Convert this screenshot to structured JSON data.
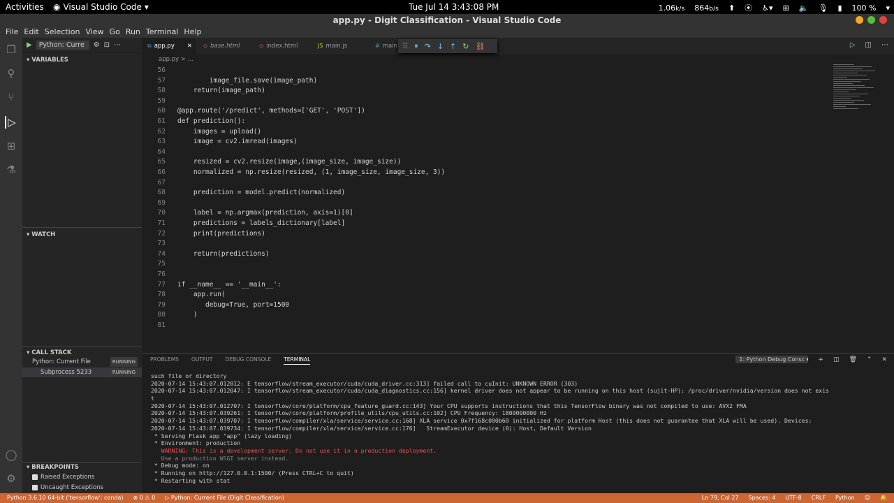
{
  "system": {
    "activities": "Activities",
    "app_name": "Visual Studio Code",
    "clock": "Tue Jul 14   3:43:08 PM",
    "net_down": "1.06",
    "net_down_unit": "k/s",
    "net_up": "864",
    "net_up_unit": "b/s",
    "battery": "100 %"
  },
  "window": {
    "title": "app.py - Digit Classification - Visual Studio Code"
  },
  "menu": [
    "File",
    "Edit",
    "Selection",
    "View",
    "Go",
    "Run",
    "Terminal",
    "Help"
  ],
  "sidebar": {
    "config": "Python: Curre",
    "variables": "VARIABLES",
    "watch": "WATCH",
    "call_stack": "CALL STACK",
    "cs_items": [
      {
        "label": "Python: Current File",
        "status": "RUNNING"
      },
      {
        "label": "Subprocess 5233",
        "status": "RUNNING"
      }
    ],
    "breakpoints": "BREAKPOINTS",
    "bp_items": [
      "Raised Exceptions",
      "Uncaught Exceptions"
    ]
  },
  "tabs": [
    "app.py",
    "base.html",
    "index.html",
    "main.js",
    "main."
  ],
  "breadcrumb": "app.py > ...",
  "code": [
    {
      "n": "56",
      "t": ""
    },
    {
      "n": "57",
      "t": "        image_file.save(image_path)"
    },
    {
      "n": "58",
      "t": "    return(image_path)"
    },
    {
      "n": "59",
      "t": ""
    },
    {
      "n": "60",
      "t": "@app.route('/predict', methods=['GET', 'POST'])"
    },
    {
      "n": "61",
      "t": "def prediction():"
    },
    {
      "n": "62",
      "t": "    images = upload()"
    },
    {
      "n": "63",
      "t": "    image = cv2.imread(images)"
    },
    {
      "n": "64",
      "t": ""
    },
    {
      "n": "65",
      "t": "    resized = cv2.resize(image,(image_size, image_size))"
    },
    {
      "n": "66",
      "t": "    normalized = np.resize(resized, (1, image_size, image_size, 3))"
    },
    {
      "n": "67",
      "t": ""
    },
    {
      "n": "68",
      "t": "    prediction = model.predict(normalized)"
    },
    {
      "n": "69",
      "t": ""
    },
    {
      "n": "70",
      "t": "    label = np.argmax(prediction, axis=1)[0]"
    },
    {
      "n": "71",
      "t": "    predictions = labels_dictionary[label]"
    },
    {
      "n": "72",
      "t": "    print(predictions)"
    },
    {
      "n": "73",
      "t": ""
    },
    {
      "n": "74",
      "t": "    return(predictions)"
    },
    {
      "n": "75",
      "t": ""
    },
    {
      "n": "76",
      "t": ""
    },
    {
      "n": "77",
      "t": "if __name__ == '__main__':"
    },
    {
      "n": "78",
      "t": "    app.run("
    },
    {
      "n": "79",
      "t": "       debug=True, port=1500"
    },
    {
      "n": "80",
      "t": "    )"
    },
    {
      "n": "81",
      "t": ""
    }
  ],
  "panel": {
    "tabs": [
      "PROBLEMS",
      "OUTPUT",
      "DEBUG CONSOLE",
      "TERMINAL"
    ],
    "terminal_select": "1: Python Debug Consc"
  },
  "terminal": [
    {
      "c": "",
      "t": "such file or directory"
    },
    {
      "c": "",
      "t": "2020-07-14 15:43:07.012012: E tensorflow/stream_executor/cuda/cuda_driver.cc:313] failed call to cuInit: UNKNOWN ERROR (303)"
    },
    {
      "c": "",
      "t": "2020-07-14 15:43:07.012047: I tensorflow/stream_executor/cuda/cuda_diagnostics.cc:156] kernel driver does not appear to be running on this host (sujit-HP): /proc/driver/nvidia/version does not exis"
    },
    {
      "c": "",
      "t": "t"
    },
    {
      "c": "",
      "t": "2020-07-14 15:43:07.012707: I tensorflow/core/platform/cpu_feature_guard.cc:143] Your CPU supports instructions that this TensorFlow binary was not compiled to use: AVX2 FMA"
    },
    {
      "c": "",
      "t": "2020-07-14 15:43:07.039261: I tensorflow/core/platform/profile_utils/cpu_utils.cc:102] CPU Frequency: 1800000000 Hz"
    },
    {
      "c": "",
      "t": "2020-07-14 15:43:07.039707: I tensorflow/compiler/xla/service/service.cc:168] XLA service 0x7f168c000b60 initialized for platform Host (this does not guarantee that XLA will be used). Devices:"
    },
    {
      "c": "",
      "t": "2020-07-14 15:43:07.039734: I tensorflow/compiler/xla/service/service.cc:176]   StreamExecutor device (0): Host, Default Version"
    },
    {
      "c": "",
      "t": " * Serving Flask app \"app\" (lazy loading)"
    },
    {
      "c": "",
      "t": " * Environment: production"
    },
    {
      "c": "red",
      "t": "   WARNING: This is a development server. Do not use it in a production deployment."
    },
    {
      "c": "dim",
      "t": "   Use a production WSGI server instead."
    },
    {
      "c": "",
      "t": " * Debug mode: on"
    },
    {
      "c": "",
      "t": " * Running on http://127.0.0.1:1500/ (Press CTRL+C to quit)"
    },
    {
      "c": "",
      "t": " * Restarting with stat"
    }
  ],
  "status": {
    "interpreter": "Python 3.6.10 64-bit ('tensorflow': conda)",
    "problems": "⊗ 0 ⚠ 0",
    "debug": "Python: Current File (Digit Classification)",
    "cursor": "Ln 79, Col 27",
    "spaces": "Spaces: 4",
    "encoding": "UTF-8",
    "eol": "CRLF",
    "language": "Python"
  }
}
